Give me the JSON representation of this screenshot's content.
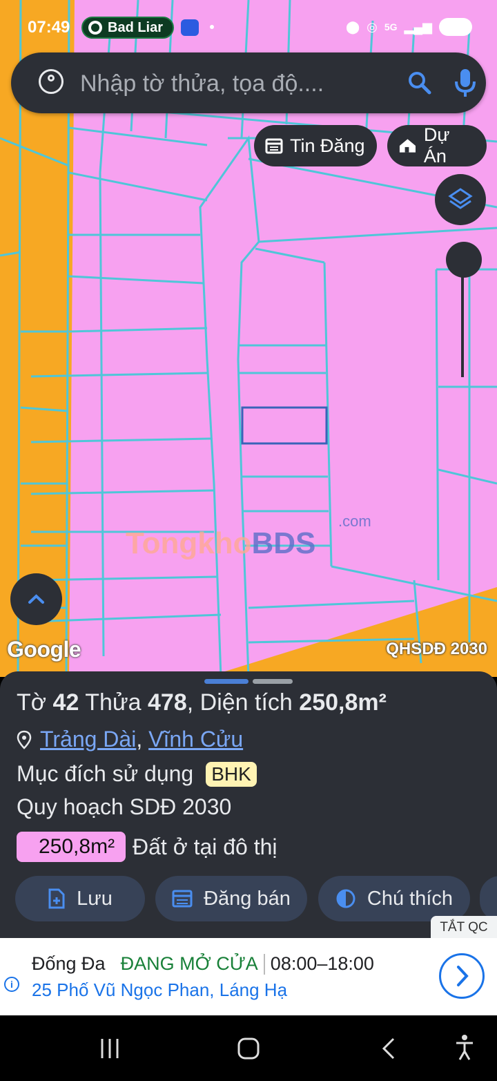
{
  "status_bar": {
    "time": "07:49",
    "media_label": "Bad Liar",
    "battery": "100",
    "network": "5G"
  },
  "search": {
    "placeholder": "Nhập tờ thửa, tọa độ...."
  },
  "chips": {
    "news_label": "Tin Đăng",
    "projects_label": "Dự Án"
  },
  "map": {
    "google_label": "Google",
    "overlay_label": "QHSDĐ 2030",
    "watermark": {
      "brand_a": "Tongkho",
      "brand_b": "BDS",
      "suffix": ".com"
    },
    "colors": {
      "residential": "#f7a1f0",
      "road": "#f7a823",
      "parcel_line": "#4fc6d8"
    }
  },
  "parcel": {
    "sheet_label": "Tờ",
    "sheet_no": "42",
    "plot_label": "Thửa",
    "plot_no": "478",
    "area_label": "Diện tích",
    "area": "250,8m²",
    "ward": "Trảng Dài",
    "district": "Vĩnh Cửu",
    "purpose_label": "Mục đích sử dụng",
    "purpose_code": "BHK",
    "plan_label": "Quy hoạch SDĐ 2030",
    "plan_area": "250,8m²",
    "plan_desc": "Đất ở tại đô thị"
  },
  "actions": {
    "save": "Lưu",
    "post_sale": "Đăng bán",
    "legend": "Chú thích"
  },
  "ad": {
    "close_label": "TẮT QC",
    "name": "Đống Đa",
    "status": "ĐANG MỞ CỬA",
    "hours": "08:00–18:00",
    "address": "25 Phố Vũ Ngọc Phan, Láng Hạ"
  }
}
